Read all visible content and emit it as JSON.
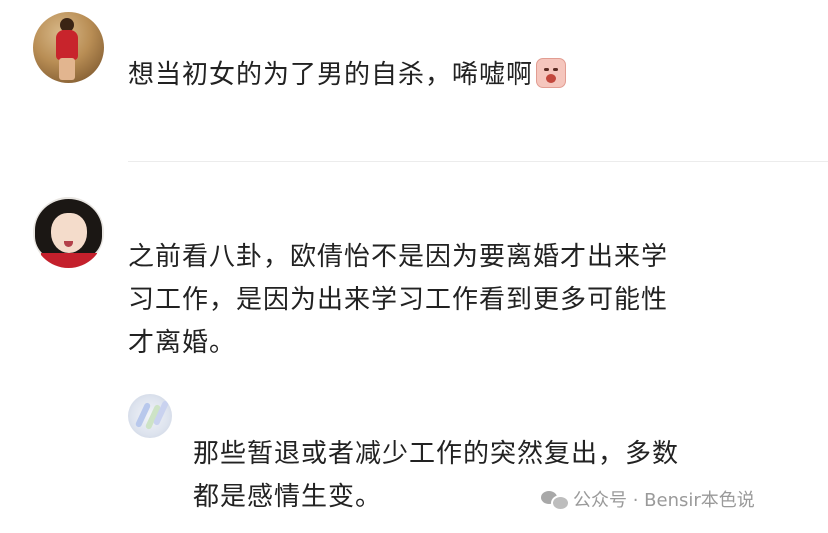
{
  "comments": [
    {
      "text": "想当初女的为了男的自杀，唏嘘啊",
      "emoji": "crying-face-emoji"
    },
    {
      "lines": [
        "之前看八卦，欧倩怡不是因为要离婚才出来学",
        "习工作，是因为出来学习工作看到更多可能性",
        "才离婚。"
      ]
    },
    {
      "lines": [
        "那些暂退或者减少工作的突然复出，多数",
        "都是感情生变。"
      ]
    }
  ],
  "watermark": {
    "icon": "wechat-icon",
    "text": "公众号 · Bensir本色说"
  },
  "colors": {
    "background": "#ffffff",
    "text": "#222222",
    "divider": "#ececec",
    "watermark": "#9a9a9a"
  }
}
